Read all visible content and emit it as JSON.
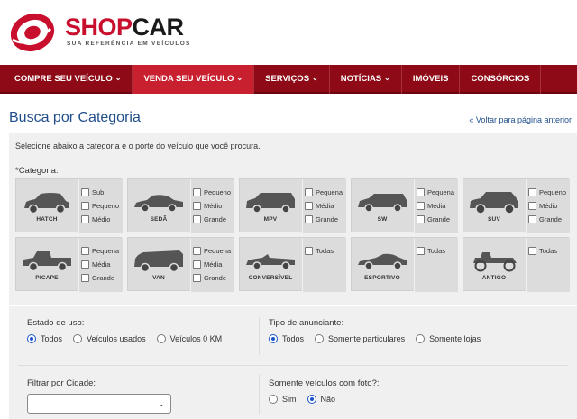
{
  "brand": {
    "name_part1": "SHOP",
    "name_part2": "CAR",
    "tagline": "SUA REFERÊNCIA EM VEÍCULOS",
    "accent": "#c8102e",
    "nav_bg": "#8e0a16"
  },
  "nav": {
    "items": [
      {
        "label": "COMPRE SEU VEÍCULO",
        "dropdown": true
      },
      {
        "label": "VENDA SEU VEÍCULO",
        "dropdown": true
      },
      {
        "label": "SERVIÇOS",
        "dropdown": true
      },
      {
        "label": "NOTÍCIAS",
        "dropdown": true
      },
      {
        "label": "IMÓVEIS",
        "dropdown": false
      },
      {
        "label": "CONSÓRCIOS",
        "dropdown": false
      }
    ]
  },
  "page": {
    "title": "Busca por Categoria",
    "back_link": "« Voltar para página anterior",
    "intro": "Selecione abaixo a categoria e o porte do veículo que você procura.",
    "category_label": "*Categoria:"
  },
  "categories": [
    {
      "name": "HATCH",
      "icon": "hatch-car-icon",
      "options": [
        "Sub",
        "Pequeno",
        "Médio"
      ]
    },
    {
      "name": "SEDÃ",
      "icon": "sedan-car-icon",
      "options": [
        "Pequeno",
        "Médio",
        "Grande"
      ]
    },
    {
      "name": "MPV",
      "icon": "minivan-car-icon",
      "options": [
        "Pequena",
        "Média",
        "Grande"
      ]
    },
    {
      "name": "SW",
      "icon": "wagon-car-icon",
      "options": [
        "Pequena",
        "Média",
        "Grande"
      ]
    },
    {
      "name": "SUV",
      "icon": "suv-car-icon",
      "options": [
        "Pequeno",
        "Médio",
        "Grande"
      ]
    },
    {
      "name": "PICAPE",
      "icon": "pickup-truck-icon",
      "options": [
        "Pequena",
        "Média",
        "Grande"
      ]
    },
    {
      "name": "VAN",
      "icon": "van-icon",
      "options": [
        "Pequena",
        "Média",
        "Grande"
      ]
    },
    {
      "name": "CONVERSÍVEL",
      "icon": "convertible-car-icon",
      "options": [
        "Todas"
      ]
    },
    {
      "name": "ESPORTIVO",
      "icon": "sports-car-icon",
      "options": [
        "Todas"
      ]
    },
    {
      "name": "ANTIGO",
      "icon": "antique-car-icon",
      "options": [
        "Todas"
      ]
    }
  ],
  "filters": {
    "estado": {
      "label": "Estado de uso:",
      "options": [
        "Todos",
        "Veículos usados",
        "Veículos 0 KM"
      ],
      "selected": 0
    },
    "anunciante": {
      "label": "Tipo de anunciante:",
      "options": [
        "Todos",
        "Somente particulares",
        "Somente lojas"
      ],
      "selected": 0
    },
    "cidade": {
      "label": "Filtrar por Cidade:",
      "value": ""
    },
    "foto": {
      "label": "Somente veículos com foto?:",
      "options": [
        "Sim",
        "Não"
      ],
      "selected": 1
    }
  }
}
